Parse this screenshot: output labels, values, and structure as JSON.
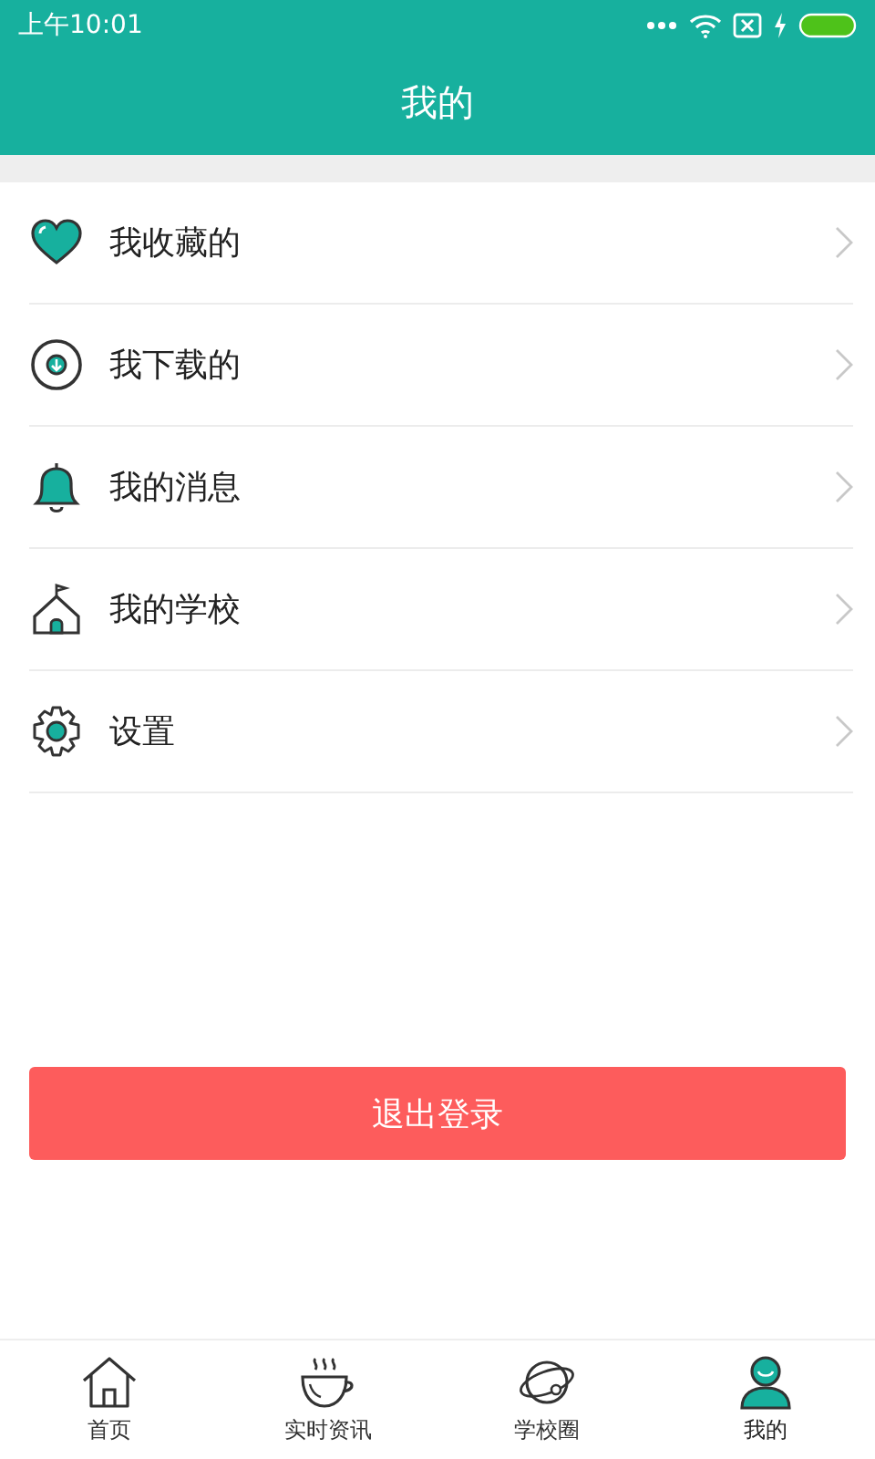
{
  "status_bar": {
    "time": "上午10:01"
  },
  "header": {
    "title": "我的"
  },
  "menu": [
    {
      "kind": "favorites",
      "label": "我收藏的"
    },
    {
      "kind": "downloads",
      "label": "我下载的"
    },
    {
      "kind": "messages",
      "label": "我的消息"
    },
    {
      "kind": "school",
      "label": "我的学校"
    },
    {
      "kind": "settings",
      "label": "设置"
    }
  ],
  "logout_button": "退出登录",
  "tabs": [
    {
      "kind": "home",
      "label": "首页",
      "selected": false
    },
    {
      "kind": "news",
      "label": "实时资讯",
      "selected": false
    },
    {
      "kind": "circle",
      "label": "学校圈",
      "selected": false
    },
    {
      "kind": "me",
      "label": "我的",
      "selected": true
    }
  ]
}
